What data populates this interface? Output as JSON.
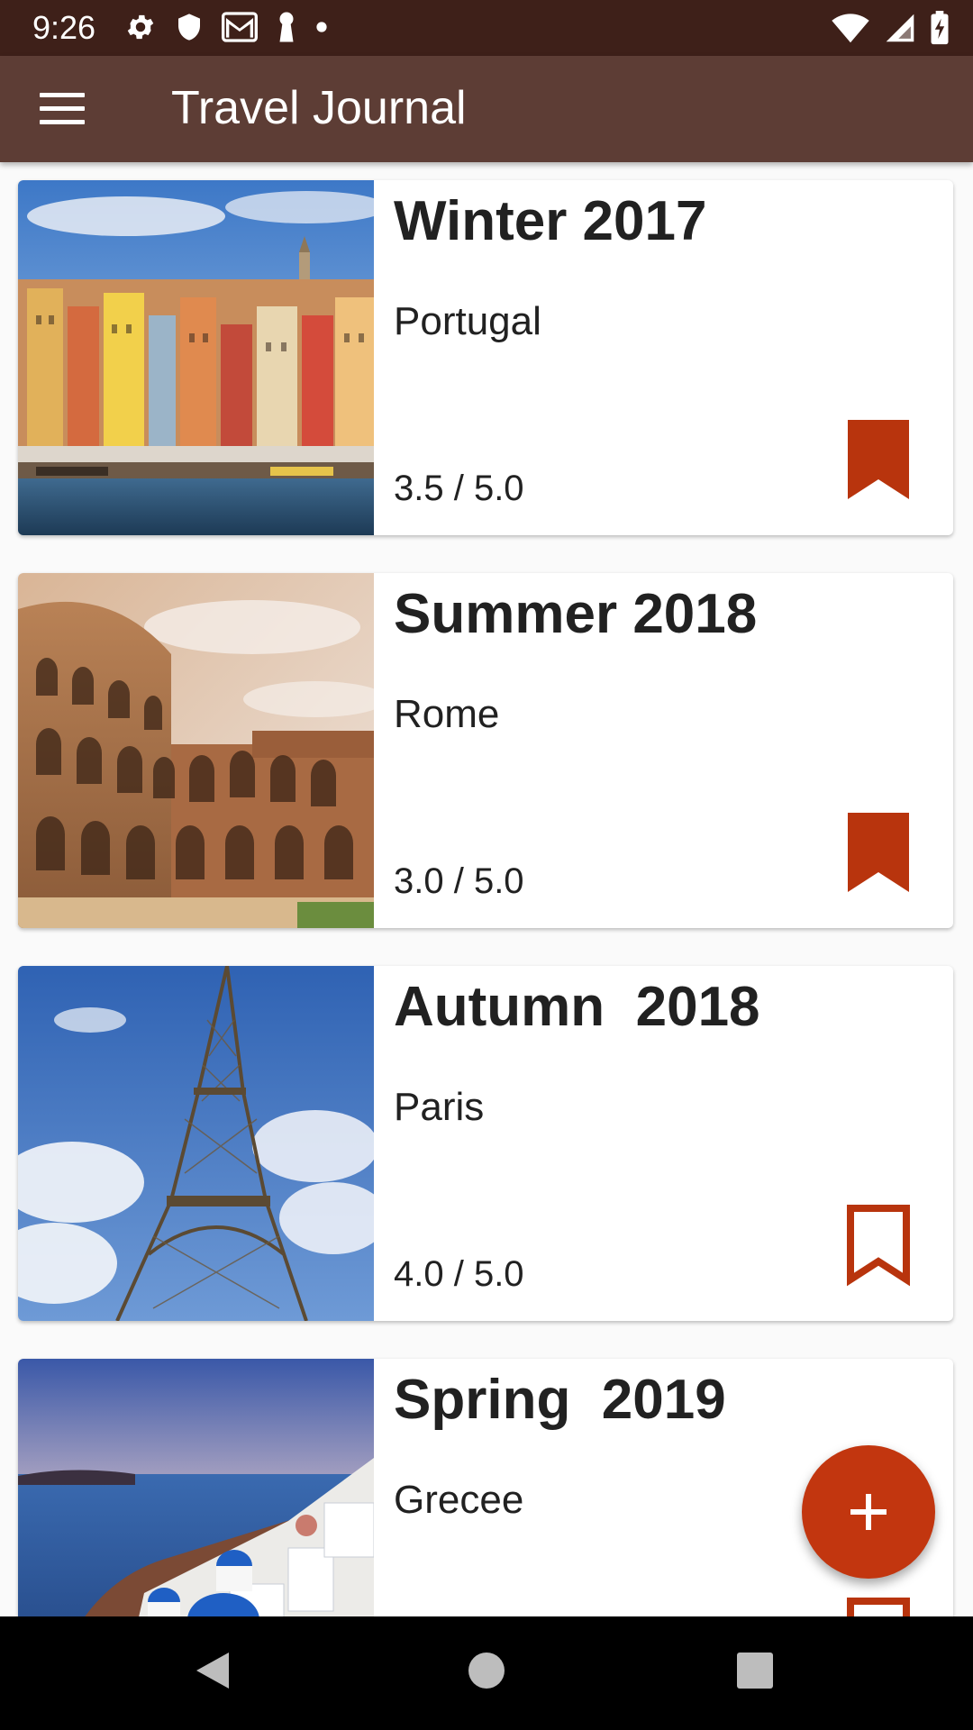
{
  "status_bar": {
    "time": "9:26",
    "left_icons": [
      "settings-icon",
      "shield-icon",
      "gmail-icon",
      "keyhole-icon",
      "dot-icon"
    ],
    "right_icons": [
      "wifi-icon",
      "signal-icon",
      "battery-icon"
    ]
  },
  "app_bar": {
    "title": "Travel Journal",
    "menu_icon": "hamburger-menu-icon"
  },
  "trips": [
    {
      "season": "Winter 2017",
      "place": "Portugal",
      "rating": "3.5 / 5.0",
      "bookmarked": true
    },
    {
      "season": "Summer 2018",
      "place": "Rome",
      "rating": "3.0 / 5.0",
      "bookmarked": true
    },
    {
      "season": "Autumn  2018",
      "place": "Paris",
      "rating": "4.0 / 5.0",
      "bookmarked": false
    },
    {
      "season": "Spring  2019",
      "place": "Grecee",
      "rating": "",
      "bookmarked": false
    }
  ],
  "fab": {
    "icon": "plus-icon"
  },
  "nav_bar": {
    "icons": [
      "back-icon",
      "home-icon",
      "recents-icon"
    ]
  },
  "colors": {
    "status_bar": "#3e2019",
    "app_bar": "#5d3d35",
    "accent": "#c2360f",
    "bookmark": "#b8340d"
  }
}
